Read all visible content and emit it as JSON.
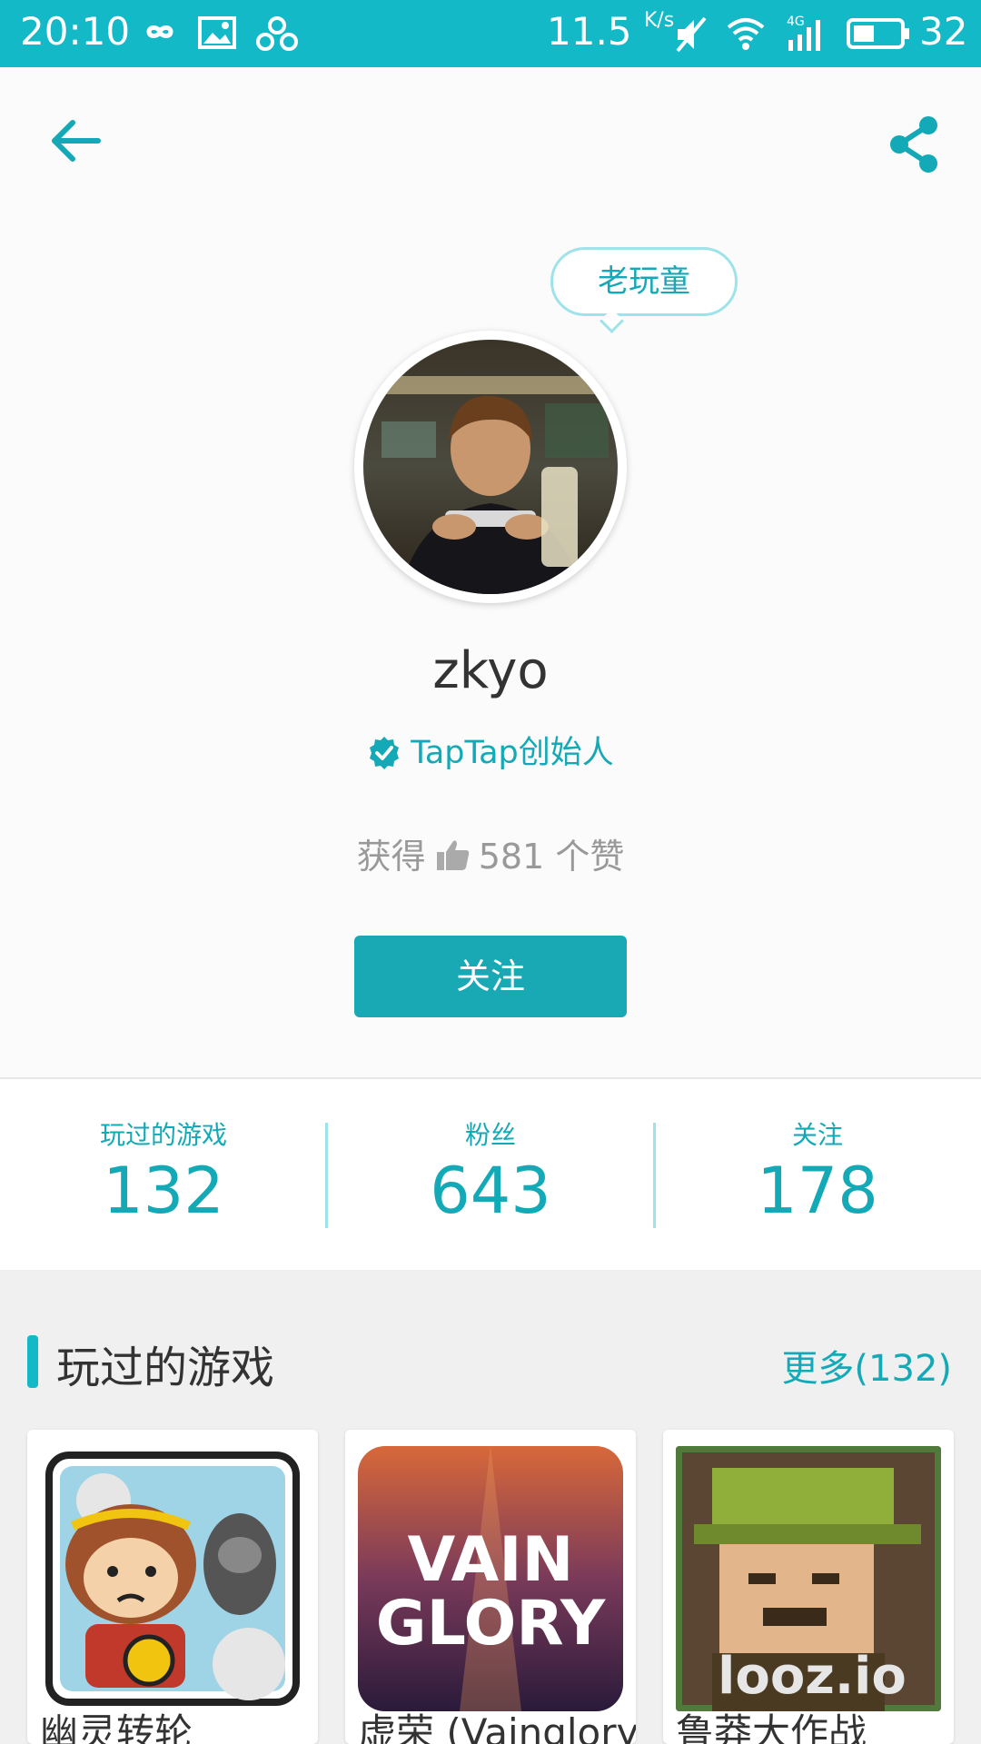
{
  "status_bar": {
    "time": "20:10",
    "speed": "11.5",
    "speed_unit": "K/s",
    "battery": "32"
  },
  "profile": {
    "badge": "老玩童",
    "username": "zkyo",
    "verified_title": "TapTap创始人",
    "likes_prefix": "获得",
    "likes_count": "581",
    "likes_suffix": "个赞",
    "follow_label": "关注"
  },
  "stats": [
    {
      "label": "玩过的游戏",
      "value": "132"
    },
    {
      "label": "粉丝",
      "value": "643"
    },
    {
      "label": "关注",
      "value": "178"
    }
  ],
  "played_games": {
    "title": "玩过的游戏",
    "more": "更多(132)",
    "items": [
      {
        "title": "幽灵转轮"
      },
      {
        "title": "虚荣 (Vainglory)"
      },
      {
        "title": "鲁莽大作战"
      }
    ]
  },
  "colors": {
    "accent": "#14b9c8",
    "button": "#18a9b5"
  }
}
